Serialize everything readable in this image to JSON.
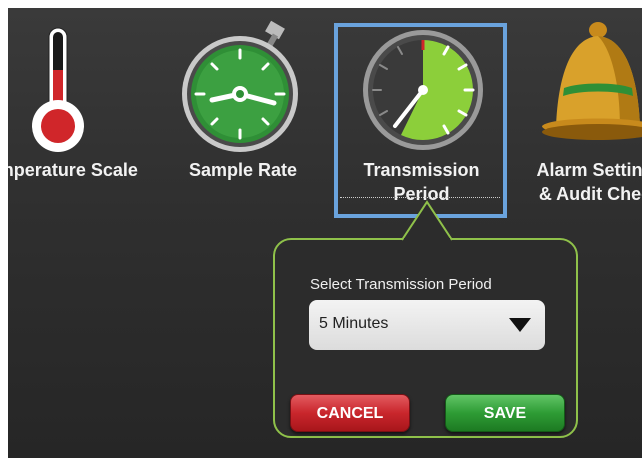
{
  "settings": [
    {
      "id": "temperature_scale",
      "label_line1": "Temperature Scale",
      "label_line2": ""
    },
    {
      "id": "sample_rate",
      "label_line1": "Sample Rate",
      "label_line2": ""
    },
    {
      "id": "transmission_period",
      "label_line1": "Transmission",
      "label_line2": "Period",
      "selected": true
    },
    {
      "id": "alarm_settings",
      "label_line1": "Alarm Settings",
      "label_line2": "& Audit Check"
    }
  ],
  "popup": {
    "title": "Select Transmission Period",
    "selected_value": "5 Minutes",
    "cancel_label": "CANCEL",
    "save_label": "SAVE"
  },
  "icons": {
    "temperature": "thermometer-icon",
    "sample_rate": "stopwatch-icon",
    "transmission": "clock-gauge-icon",
    "alarm": "bell-icon"
  },
  "colors": {
    "selection_border": "#6aa3dd",
    "popup_border": "#8fc14a",
    "cancel": "#c9262c",
    "save": "#2e9c35"
  }
}
